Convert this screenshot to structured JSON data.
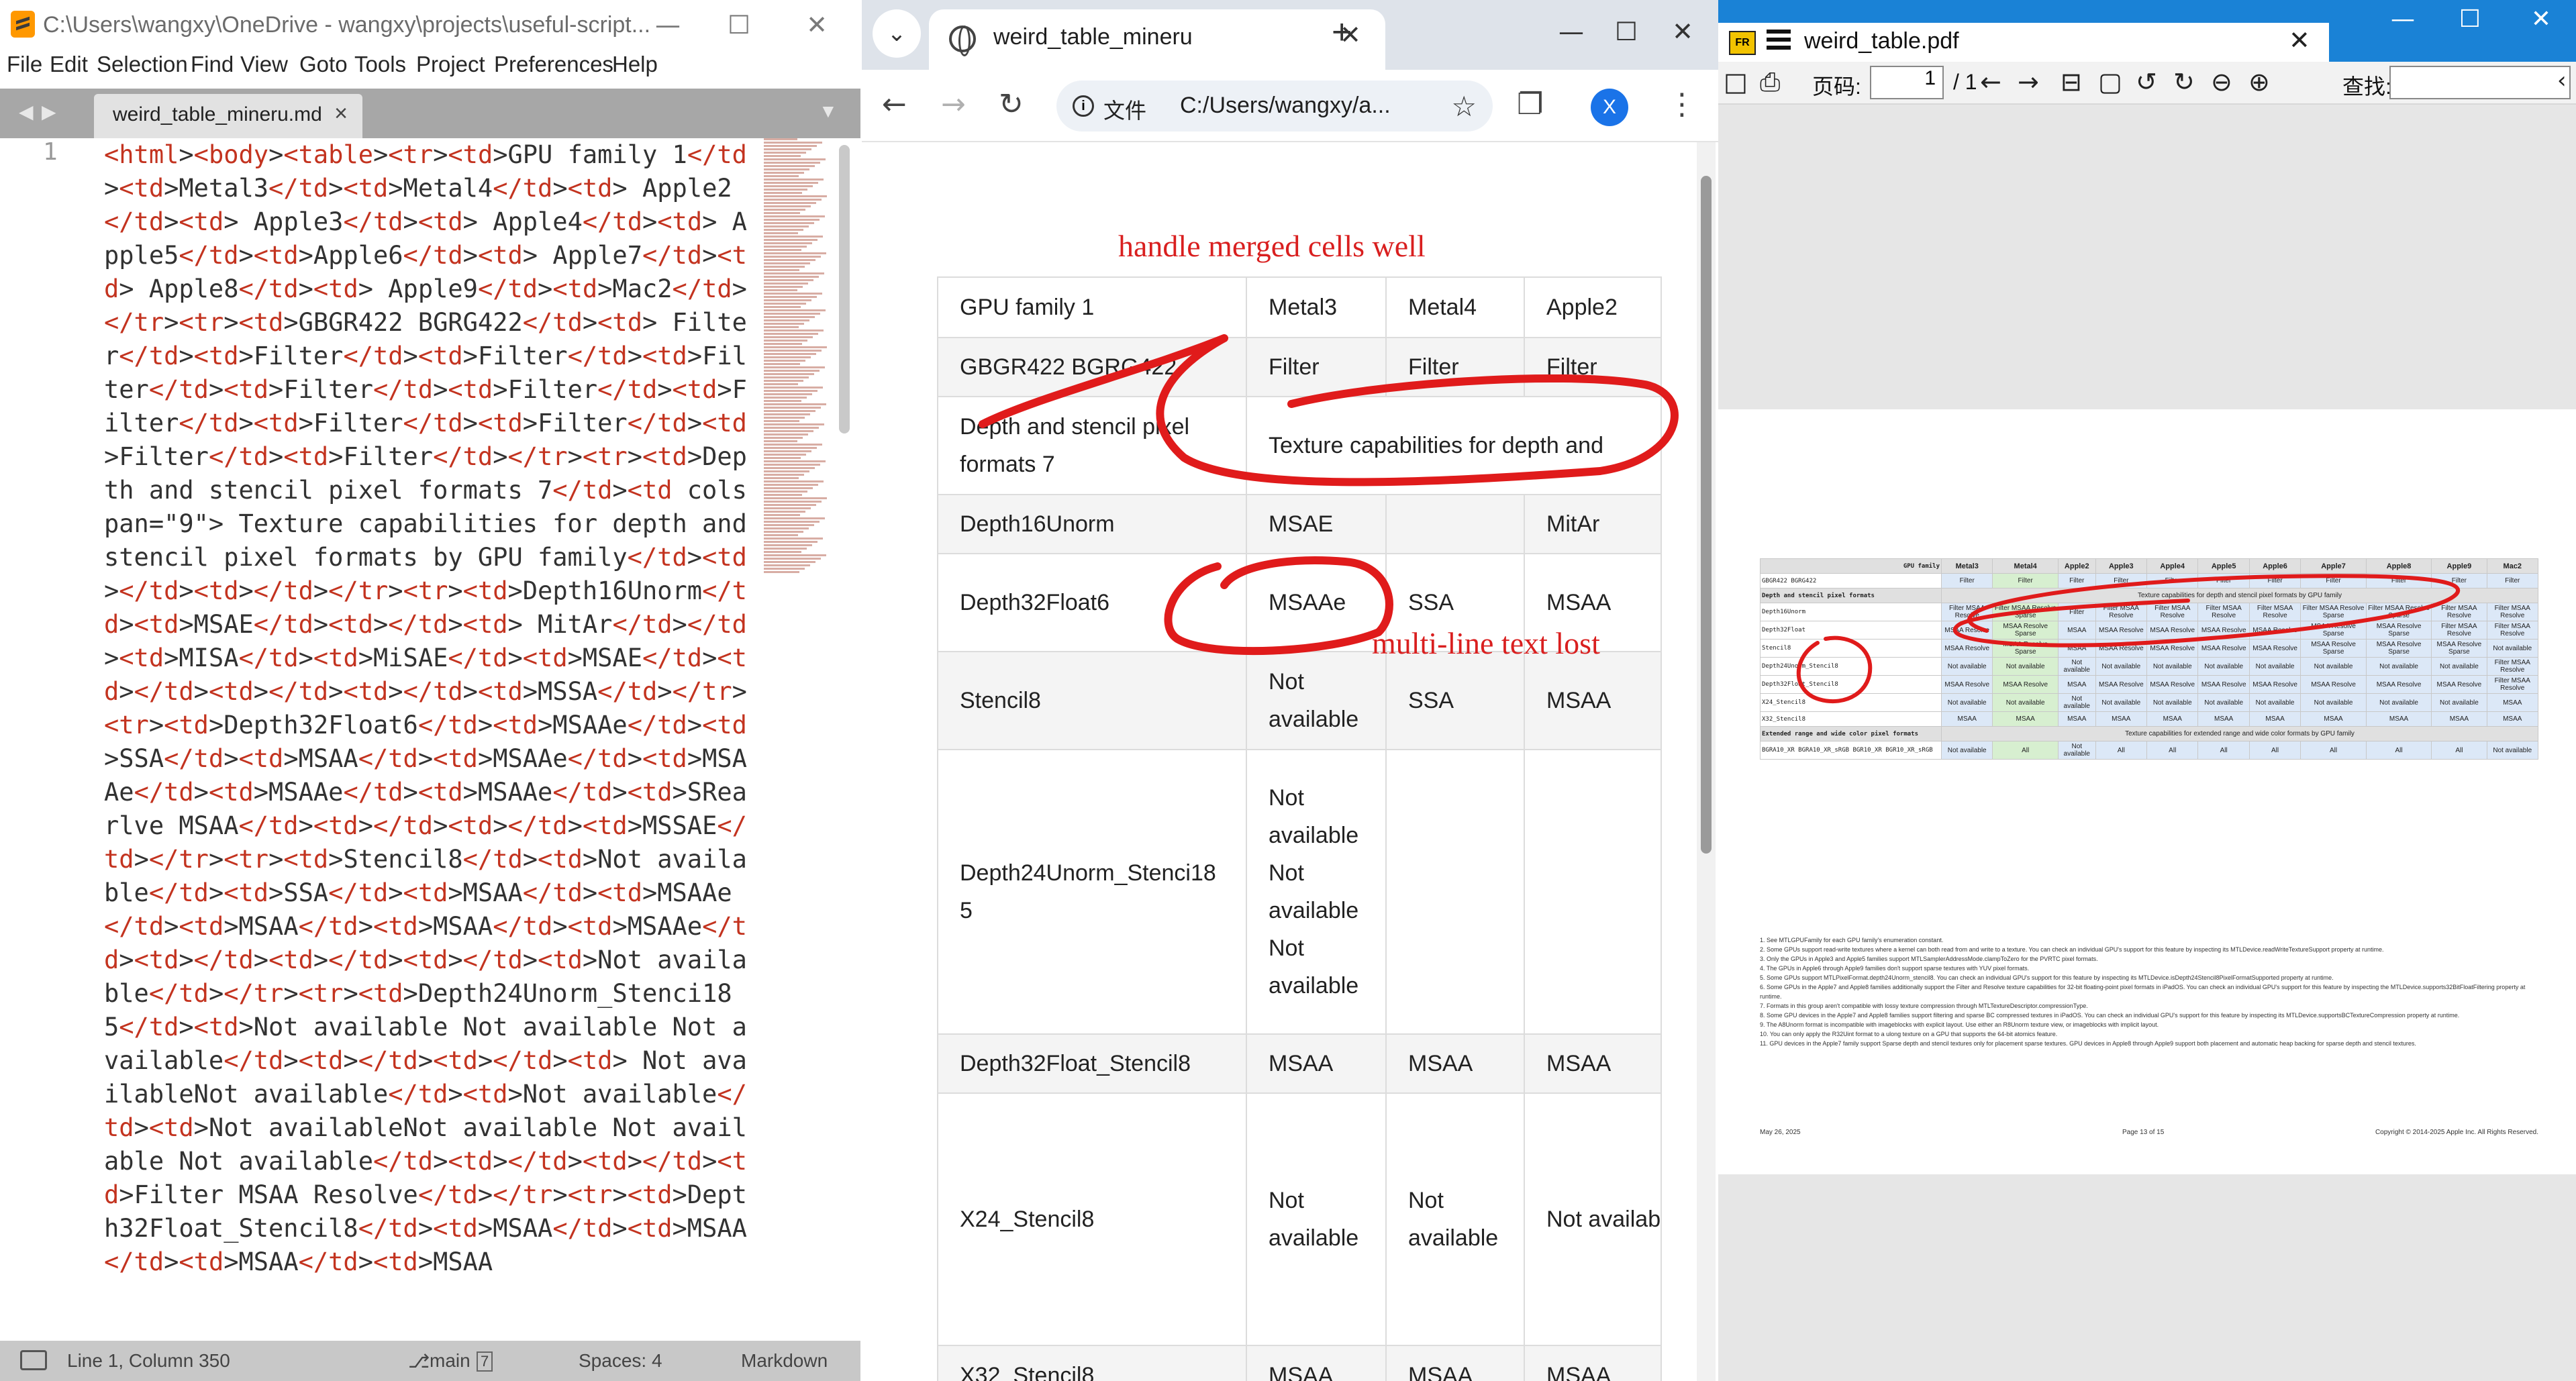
{
  "sublime": {
    "title": "C:\\Users\\wangxy\\OneDrive - wangxy\\projects\\useful-script...",
    "controls": {
      "minimize": "—",
      "maximize": "☐",
      "close": "✕"
    },
    "menu": [
      "File",
      "Edit",
      "Selection",
      "Find",
      "View",
      "Goto",
      "Tools",
      "Project",
      "Preferences",
      "Help"
    ],
    "nav": {
      "back": "◀",
      "forward": "▶",
      "dropdown": "▼"
    },
    "tab": {
      "label": "weird_table_mineru.md",
      "close": "×"
    },
    "line_number": "1",
    "code": "<html><body><table><tr><td>GPU family 1</td><td>Metal3</td><td>Metal4</td><td> Apple2</td><td> Apple3</td><td> Apple4</td><td> Apple5</td><td>Apple6</td><td> Apple7</td><td> Apple8</td><td> Apple9</td><td>Mac2</td></tr><tr><td>GBGR422 BGRG422</td><td> Filter</td><td>Filter</td><td>Filter</td><td>Filter</td><td>Filter</td><td>Filter</td><td>Filter</td><td>Filter</td><td>Filter</td><td>Filter</td><td>Filter</td></tr><tr><td>Depth and stencil pixel formats 7</td><td colspan=\"9\"> Texture capabilities for depth and stencil pixel formats by GPU family</td><td></td><td></td></tr><tr><td>Depth16Unorm</td><td>MSAE</td><td></td><td> MitAr</td></td><td>MISA</td><td>MiSAE</td><td>MSAE</td><td></td><td></td><td></td><td>MSSA</td></tr><tr><td>Depth32Float6</td><td>MSAAe</td><td>SSA</td><td>MSAA</td><td>MSAAe</td><td>MSAAe</td><td>MSAAe</td><td>MSAAe</td><td>SRearlve MSAA</td><td></td><td></td><td>MSSAE</td></tr><tr><td>Stencil8</td><td>Not available</td><td>SSA</td><td>MSAA</td><td>MSAAe</td><td>MSAA</td><td>MSAA</td><td>MSAAe</td><td></td><td></td><td></td><td>Not available</td></tr><tr><td>Depth24Unorm_Stenci18 5</td><td>Not available Not available Not available</td><td></td><td></td><td> Not availableNot available</td><td>Not available</td><td>Not availableNot available Not available Not available</td><td></td><td></td><td>Filter MSAA Resolve</td></tr><tr><td>Depth32Float_Stencil8</td><td>MSAA</td><td>MSAA</td><td>MSAA</td><td>MSAA",
    "status": {
      "position": "Line 1, Column 350",
      "branch": "main",
      "branch_badge": "7",
      "indent": "Spaces: 4",
      "syntax": "Markdown"
    }
  },
  "chrome": {
    "tab_title": "weird_table_mineru",
    "tab_close": "✕",
    "new_tab": "+",
    "controls": {
      "minimize": "—",
      "maximize": "☐",
      "close": "✕"
    },
    "toolbar": {
      "back": "←",
      "forward": "→",
      "reload": "↻",
      "menu": "⋮",
      "extensions": "❐"
    },
    "file_chip": "文件",
    "url": "C:/Users/wangxy/a...",
    "star": "☆",
    "avatar": "X",
    "annotations": {
      "heading": "handle merged cells well",
      "note": "multi-line text lost"
    },
    "table": [
      [
        "GPU family 1",
        "Metal3",
        "Metal4",
        "Apple2"
      ],
      [
        "GBGR422 BGRG422",
        "Filter",
        "Filter",
        "Filter"
      ],
      [
        "Depth and stencil pixel formats 7",
        "Texture capabilities for depth and"
      ],
      [
        "Depth16Unorm",
        "MSAE",
        "",
        "MitAr"
      ],
      [
        "Depth32Float6",
        "MSAAe",
        "SSA",
        "MSAA"
      ],
      [
        "Stencil8",
        "Not available",
        "SSA",
        "MSAA"
      ],
      [
        "Depth24Unorm_Stenci18 5",
        "Not available Not available Not available",
        "",
        ""
      ],
      [
        "Depth32Float_Stencil8",
        "MSAA",
        "MSAA",
        "MSAA"
      ],
      [
        "X24_Stencil8",
        "Not available",
        "Not available",
        "Not availab"
      ],
      [
        "X32_Stencil8",
        "MSAA",
        "MSAA",
        "MSAA"
      ]
    ],
    "colors": {
      "annotation_red": "#e01b1b"
    }
  },
  "pdf": {
    "tab_title": "weird_table.pdf",
    "tab_close": "✕",
    "app_icon": "FR",
    "controls": {
      "minimize": "—",
      "maximize": "☐",
      "close": "✕"
    },
    "page_label": "页码:",
    "page_value": "1",
    "page_total": "/ 1",
    "search_label": "查找:",
    "tools": {
      "open": "□",
      "print": "⎙",
      "prev": "←",
      "next": "→",
      "fit_width": "⊟",
      "fit_page": "▢",
      "rotate_left": "↺",
      "rotate_right": "↻",
      "zoom_out": "⊖",
      "zoom_in": "⊕",
      "collapse": "‹"
    },
    "table_header": [
      "GPU family",
      "Metal3",
      "Metal4",
      "Apple2",
      "Apple3",
      "Apple4",
      "Apple5",
      "Apple6",
      "Apple7",
      "Apple8",
      "Apple9",
      "Mac2"
    ],
    "rows": [
      {
        "name": "GBGR422 BGRG422",
        "cells": [
          "Filter",
          "Filter",
          "Filter",
          "Filter",
          "Filter",
          "Filter",
          "Filter",
          "Filter",
          "Filter",
          "Filter",
          "Filter"
        ]
      },
      {
        "section": "Depth and stencil pixel formats",
        "span": "Texture capabilities for depth and stencil pixel formats by GPU family"
      },
      {
        "name": "Depth16Unorm",
        "cells": [
          "Filter MSAA Resolve",
          "Filter MSAA Resolve Sparse",
          "Filter",
          "Filter MSAA Resolve",
          "Filter MSAA Resolve",
          "Filter MSAA Resolve",
          "Filter MSAA Resolve",
          "Filter MSAA Resolve Sparse",
          "Filter MSAA Resolve Sparse",
          "Filter MSAA Resolve",
          "Filter MSAA Resolve"
        ]
      },
      {
        "name": "Depth32Float",
        "cells": [
          "MSAA Resolve",
          "MSAA Resolve Sparse",
          "MSAA",
          "MSAA Resolve",
          "MSAA Resolve",
          "MSAA Resolve",
          "MSAA Resolve",
          "MSAA Resolve Sparse",
          "MSAA Resolve Sparse",
          "Filter MSAA Resolve",
          "Filter MSAA Resolve"
        ]
      },
      {
        "name": "Stencil8",
        "cells": [
          "MSAA Resolve",
          "MSAA Resolve Sparse",
          "MSAA",
          "MSAA Resolve",
          "MSAA Resolve",
          "MSAA Resolve",
          "MSAA Resolve",
          "MSAA Resolve Sparse",
          "MSAA Resolve Sparse",
          "MSAA Resolve Sparse",
          "Not available"
        ]
      },
      {
        "name": "Depth24Unorm_Stencil8",
        "cells": [
          "Not available",
          "Not available",
          "Not available",
          "Not available",
          "Not available",
          "Not available",
          "Not available",
          "Not available",
          "Not available",
          "Not available",
          "Filter MSAA Resolve"
        ]
      },
      {
        "name": "Depth32Float_Stencil8",
        "cells": [
          "MSAA Resolve",
          "MSAA Resolve",
          "MSAA",
          "MSAA Resolve",
          "MSAA Resolve",
          "MSAA Resolve",
          "MSAA Resolve",
          "MSAA Resolve",
          "MSAA Resolve",
          "MSAA Resolve",
          "Filter MSAA Resolve"
        ]
      },
      {
        "name": "X24_Stencil8",
        "cells": [
          "Not available",
          "Not available",
          "Not available",
          "Not available",
          "Not available",
          "Not available",
          "Not available",
          "Not available",
          "Not available",
          "Not available",
          "MSAA"
        ]
      },
      {
        "name": "X32_Stencil8",
        "cells": [
          "MSAA",
          "MSAA",
          "MSAA",
          "MSAA",
          "MSAA",
          "MSAA",
          "MSAA",
          "MSAA",
          "MSAA",
          "MSAA",
          "MSAA"
        ]
      },
      {
        "section": "Extended range and wide color pixel formats",
        "span": "Texture capabilities for extended range and wide color formats by GPU family"
      },
      {
        "name": "BGRA10_XR BGRA10_XR_sRGB BGR10_XR BGR10_XR_sRGB",
        "cells": [
          "Not available",
          "All",
          "Not available",
          "All",
          "All",
          "All",
          "All",
          "All",
          "All",
          "All",
          "Not available"
        ]
      }
    ],
    "footnotes": [
      "1. See MTLGPUFamily for each GPU family's enumeration constant.",
      "2. Some GPUs support read-write textures where a kernel can both read from and write to a texture. You can check an individual GPU's support for this feature by inspecting its MTLDevice.readWriteTextureSupport property at runtime.",
      "3. Only the GPUs in Apple3 and Apple5 families support MTLSamplerAddressMode.clampToZero for the PVRTC pixel formats.",
      "4. The GPUs in Apple6 through Apple9 families don't support sparse textures with YUV pixel formats.",
      "5. Some GPUs support MTLPixelFormat.depth24Unorm_stencil8. You can check an individual GPU's support for this feature by inspecting its MTLDevice.isDepth24Stencil8PixelFormatSupported property at runtime.",
      "6. Some GPUs in the Apple7 and Apple8 families additionally support the Filter and Resolve texture capabilities for 32-bit floating-point pixel formats in iPadOS. You can check an individual GPU's support for this feature by inspecting the MTLDevice.supports32BitFloatFiltering property at runtime.",
      "7. Formats in this group aren't compatible with lossy texture compression through MTLTextureDescriptor.compressionType.",
      "8. Some GPU devices in the Apple7 and Apple8 families support filtering and sparse BC compressed textures in iPadOS. You can check an individual GPU's support for this feature by inspecting its MTLDevice.supportsBCTextureCompression property at runtime.",
      "9. The A8Unorm format is incompatible with imageblocks with explicit layout. Use either an R8Unorm texture view, or imageblocks with implicit layout.",
      "10. You can only apply the R32Uint format to a ulong texture on a GPU that supports the 64-bit atomics feature.",
      "11. GPU devices in the Apple7 family support Sparse depth and stencil textures only for placement sparse textures. GPU devices in Apple8 through Apple9 support both placement and automatic heap backing for sparse depth and stencil textures."
    ],
    "footer": {
      "date": "May 26, 2025",
      "page": "Page 13 of 15",
      "copyright": "Copyright © 2014-2025 Apple Inc. All Rights Reserved."
    }
  }
}
